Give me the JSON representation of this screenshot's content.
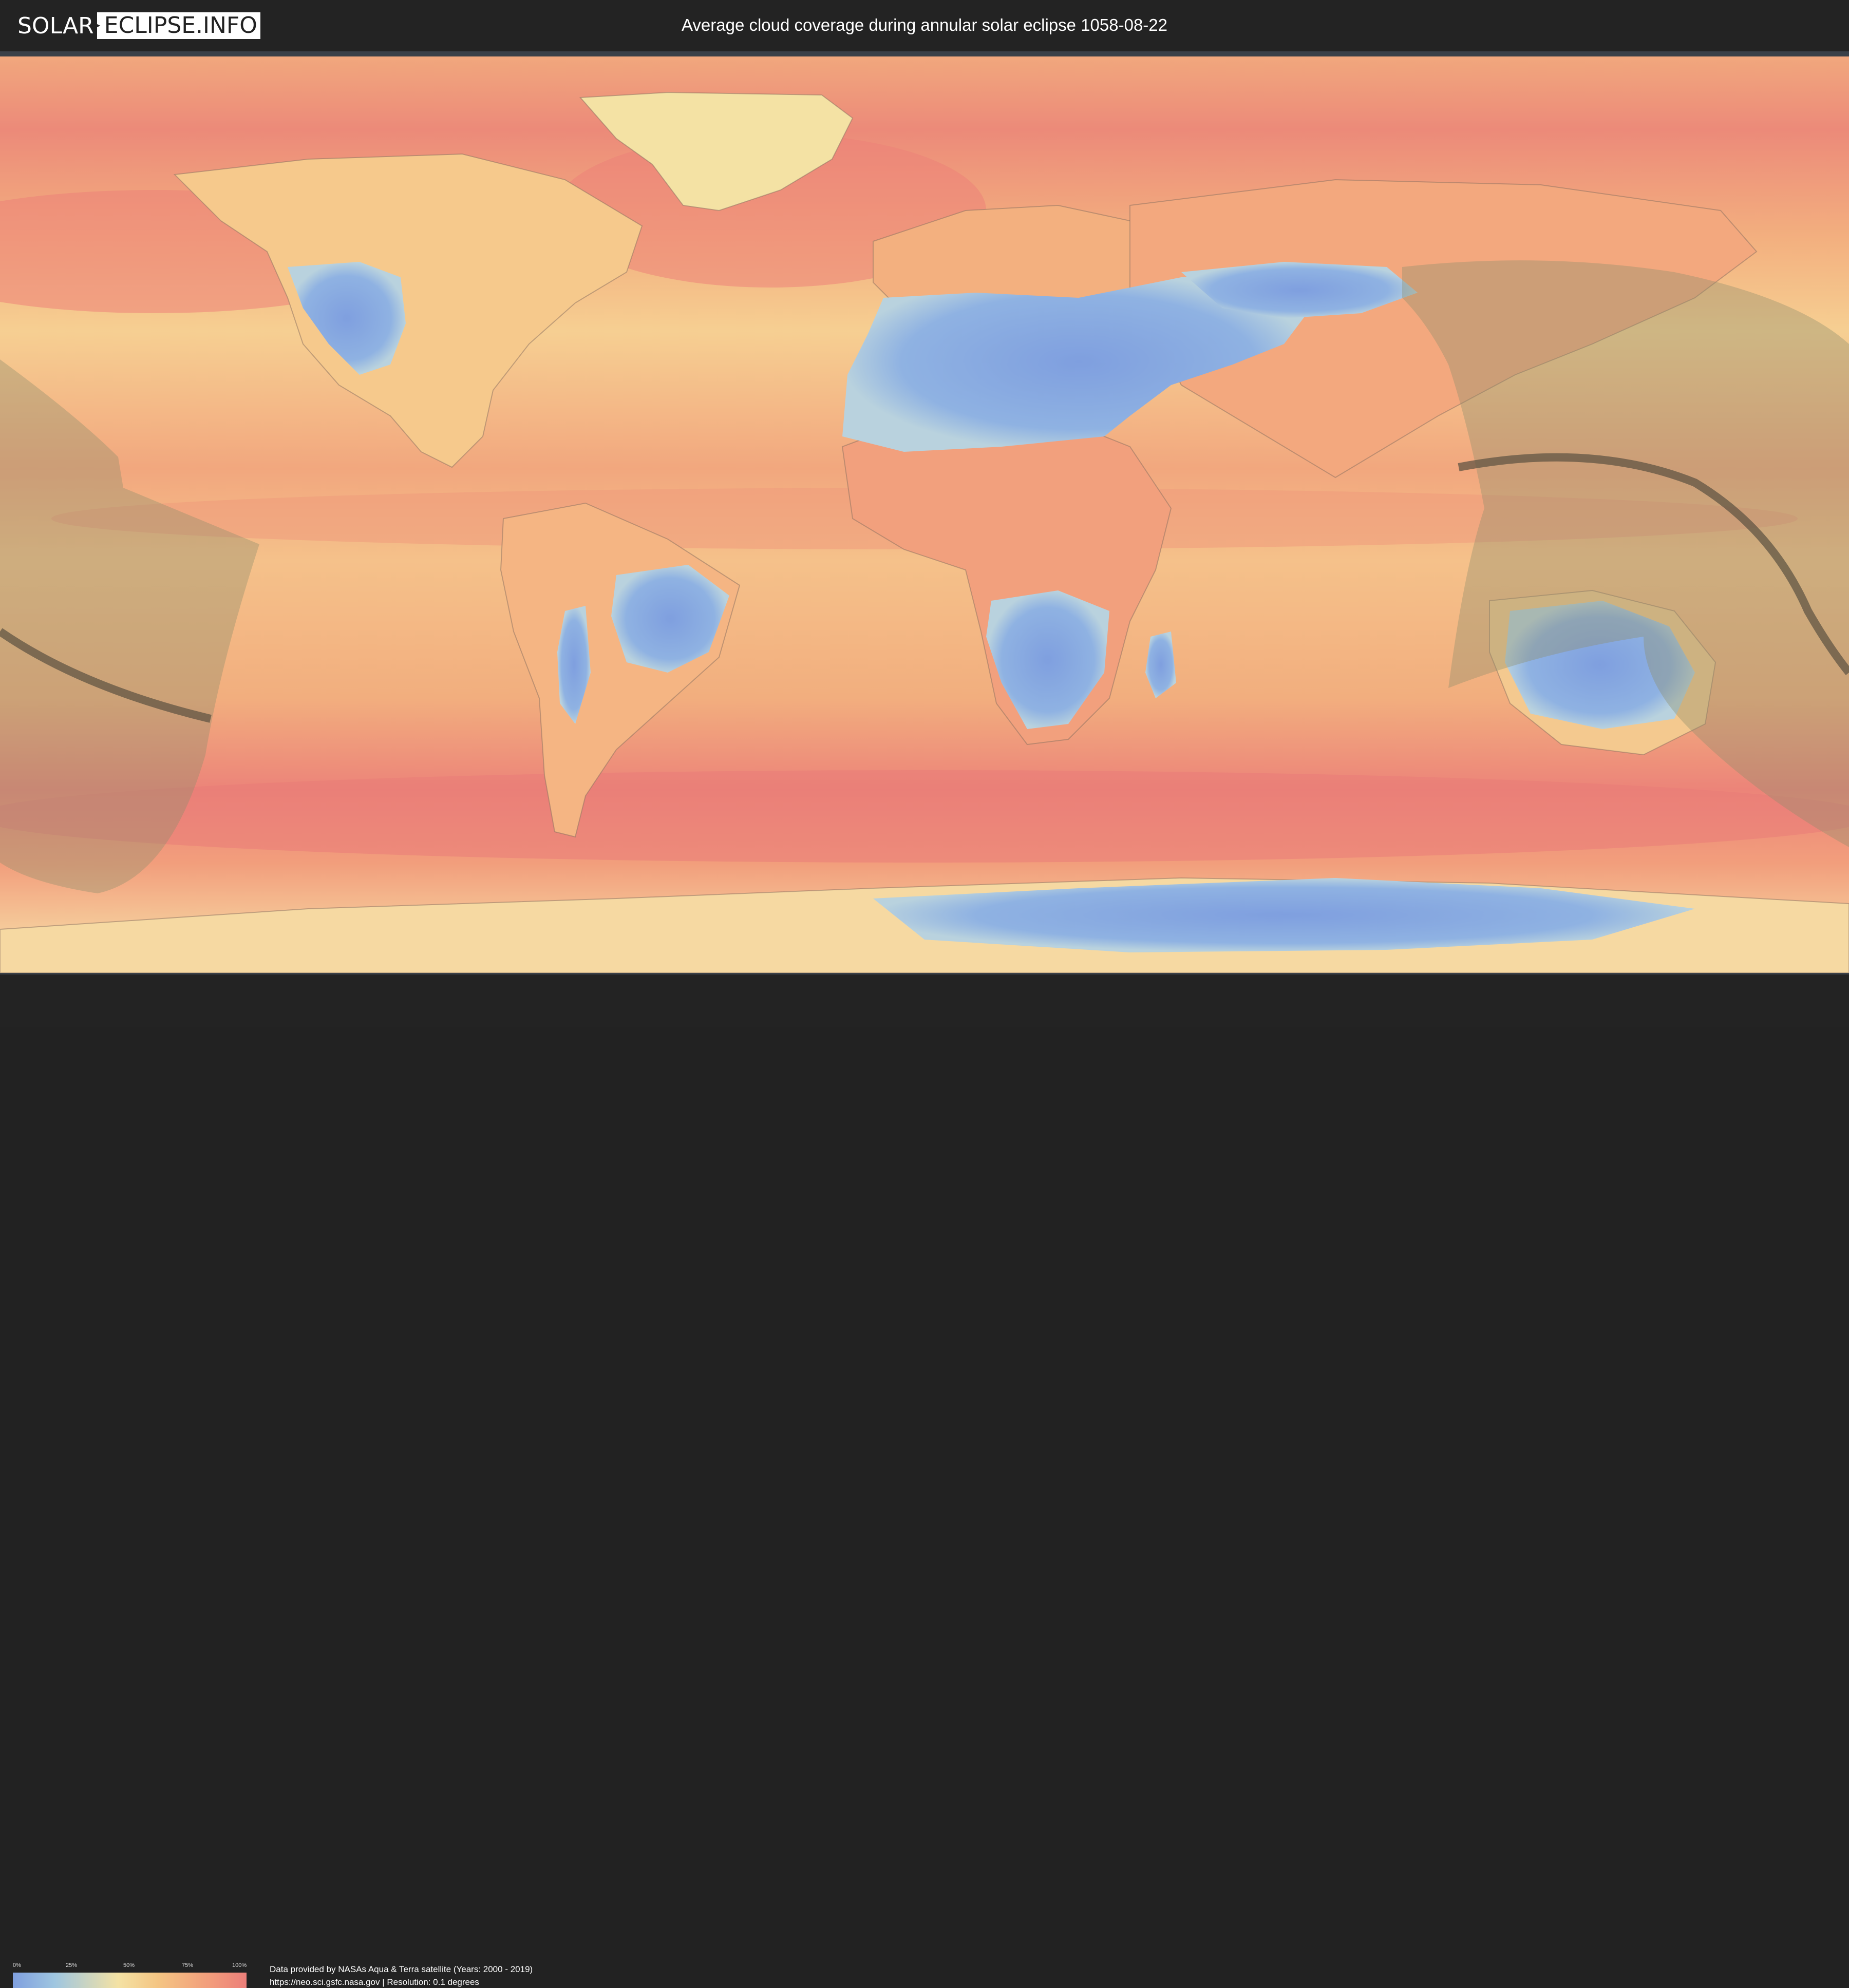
{
  "header": {
    "logo_left": "SOLAR",
    "logo_right": "ECLIPSE.INFO",
    "title": "Average cloud coverage during annular solar eclipse 1058-08-22"
  },
  "legend": {
    "ticks": [
      "0%",
      "25%",
      "50%",
      "75%",
      "100%"
    ],
    "colors": [
      "#7f9fdf",
      "#9fc6e0",
      "#f4e2a4",
      "#f4c583",
      "#f29b7b",
      "#ec7f7a"
    ]
  },
  "footer": {
    "credit_line1": "Data provided by NASAs Aqua & Terra satellite (Years: 2000 - 2019)",
    "credit_line2": "https://neo.sci.gsfc.nasa.gov | Resolution: 0.1 degrees"
  },
  "map": {
    "colors": {
      "ocean_cloudy": "#ed8a7a",
      "ocean_mid": "#f2b07f",
      "land_clear": "#85a8e0",
      "land_partly": "#f4d69c",
      "ice_clear": "#9fbfea",
      "eclipse_shadow": "#8d8d6b",
      "eclipse_path": "#5a5040"
    }
  }
}
